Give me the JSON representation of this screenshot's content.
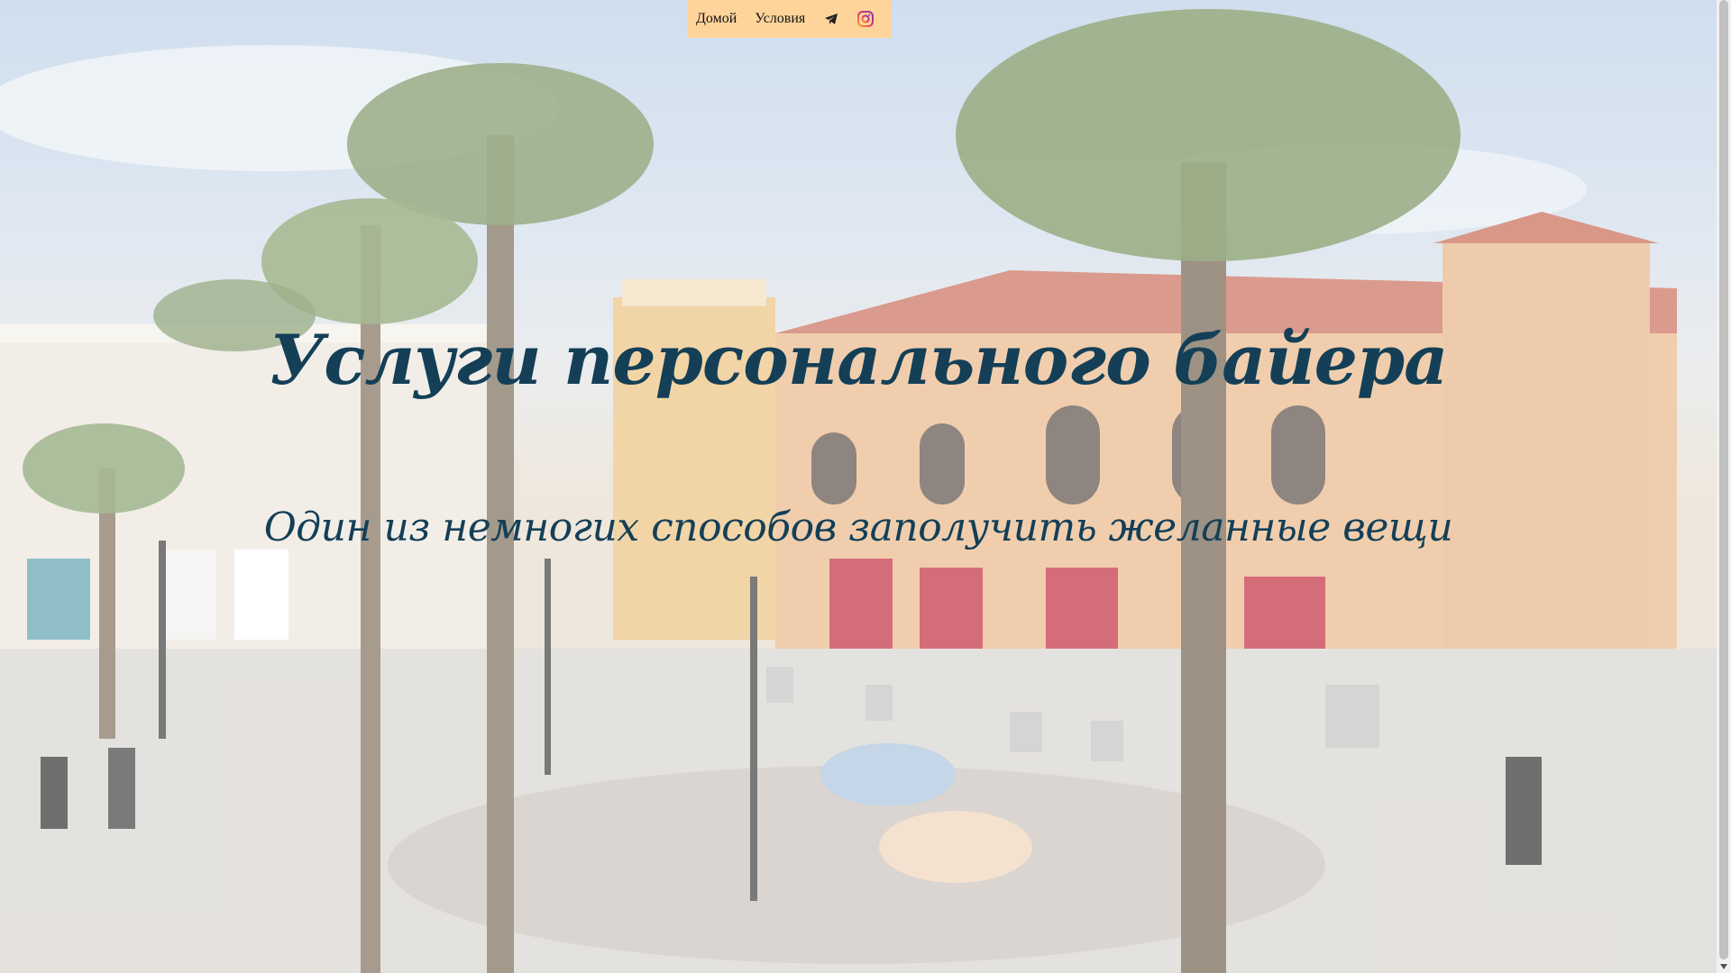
{
  "nav": {
    "items": [
      {
        "label": "Домой"
      },
      {
        "label": "Условия"
      }
    ],
    "icons": [
      "telegram-icon",
      "instagram-icon"
    ],
    "background": "#ffd49a"
  },
  "hero": {
    "title": "Услуги персонального байера",
    "subtitle": "Один из немногих способов заполучить желанные вещи",
    "text_color": "#143f57"
  },
  "scrollbar": {
    "arrow_icon": "chevron-down-icon"
  }
}
